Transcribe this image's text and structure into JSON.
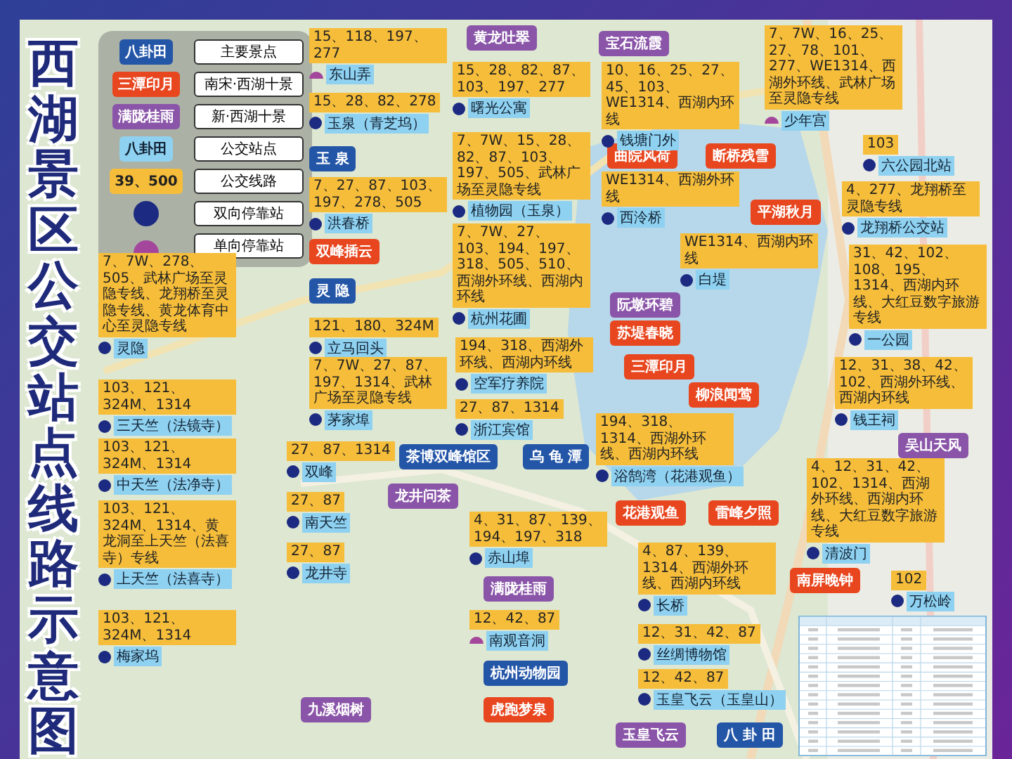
{
  "title": "西湖景区公交站点线路示意图",
  "legend": [
    {
      "kind": "main",
      "sample": "八卦田",
      "meaning": "主要景点"
    },
    {
      "kind": "old",
      "sample": "三潭印月",
      "meaning": "南宋·西湖十景"
    },
    {
      "kind": "new",
      "sample": "满陇桂雨",
      "meaning": "新·西湖十景"
    },
    {
      "kind": "stop",
      "sample": "八卦田",
      "meaning": "公交站点"
    },
    {
      "kind": "routes",
      "sample": "39、500",
      "meaning": "公交线路"
    },
    {
      "kind": "double",
      "meaning": "双向停靠站"
    },
    {
      "kind": "single",
      "meaning": "单向停靠站"
    }
  ],
  "scenic_spots": [
    {
      "name": "黄龙吐翠",
      "kind": "new"
    },
    {
      "name": "宝石流霞",
      "kind": "new"
    },
    {
      "name": "玉 泉",
      "kind": "main"
    },
    {
      "name": "曲院风荷",
      "kind": "old"
    },
    {
      "name": "断桥残雪",
      "kind": "old"
    },
    {
      "name": "平湖秋月",
      "kind": "old"
    },
    {
      "name": "双峰插云",
      "kind": "old"
    },
    {
      "name": "灵 隐",
      "kind": "main"
    },
    {
      "name": "阮墩环碧",
      "kind": "new"
    },
    {
      "name": "苏堤春晓",
      "kind": "old"
    },
    {
      "name": "三潭印月",
      "kind": "old"
    },
    {
      "name": "柳浪闻莺",
      "kind": "old"
    },
    {
      "name": "吴山天风",
      "kind": "new"
    },
    {
      "name": "茶博双峰馆区",
      "kind": "main"
    },
    {
      "name": "乌 龟 潭",
      "kind": "main"
    },
    {
      "name": "雷峰夕照",
      "kind": "old"
    },
    {
      "name": "花港观鱼",
      "kind": "old"
    },
    {
      "name": "南屏晚钟",
      "kind": "old"
    },
    {
      "name": "龙井问茶",
      "kind": "new"
    },
    {
      "name": "满陇桂雨",
      "kind": "new"
    },
    {
      "name": "杭州动物园",
      "kind": "main"
    },
    {
      "name": "虎跑梦泉",
      "kind": "old"
    },
    {
      "name": "玉皇飞云",
      "kind": "new"
    },
    {
      "name": "八 卦 田",
      "kind": "main"
    },
    {
      "name": "九溪烟树",
      "kind": "new"
    }
  ],
  "stops": [
    {
      "name": "东山弄",
      "kind": "single",
      "routes": "15、118、197、277"
    },
    {
      "name": "曙光公寓",
      "kind": "double",
      "routes": "15、28、82、87、103、197、277"
    },
    {
      "name": "钱塘门外",
      "kind": "double",
      "routes": "10、16、25、27、45、103、WE1314、西湖内环线"
    },
    {
      "name": "少年宫",
      "kind": "single",
      "routes": "7、7W、16、25、27、78、101、277、WE1314、西湖外环线、武林广场至灵隐专线"
    },
    {
      "name": "六公园北站",
      "kind": "double",
      "routes": "103"
    },
    {
      "name": "龙翔桥公交站",
      "kind": "double",
      "routes": "4、277、龙翔桥至灵隐专线"
    },
    {
      "name": "玉泉（青芝坞）",
      "kind": "double",
      "routes": "15、28、82、278"
    },
    {
      "name": "植物园（玉泉）",
      "kind": "double",
      "routes": "7、7W、15、28、82、87、103、197、505、武林广场至灵隐专线"
    },
    {
      "name": "西泠桥",
      "kind": "double",
      "routes": "WE1314、西湖外环线"
    },
    {
      "name": "白堤",
      "kind": "double",
      "routes": "WE1314、西湖内环线"
    },
    {
      "name": "一公园",
      "kind": "double",
      "routes": "31、42、102、108、195、1314、西湖内环线、大红豆数字旅游专线"
    },
    {
      "name": "洪春桥",
      "kind": "double",
      "routes": "7、27、87、103、197、278、505"
    },
    {
      "name": "杭州花圃",
      "kind": "double",
      "routes": "7、7W、27、103、194、197、318、505、510、西湖外环线、西湖内环线"
    },
    {
      "name": "灵隐",
      "kind": "double",
      "routes": "7、7W、278、505、武林广场至灵隐专线、龙翔桥至灵隐专线、黄龙体育中心至灵隐专线"
    },
    {
      "name": "立马回头",
      "kind": "double",
      "routes": "121、180、324M"
    },
    {
      "name": "三天竺（法镜寺）",
      "kind": "double",
      "routes": "103、121、324M、1314"
    },
    {
      "name": "中天竺（法净寺）",
      "kind": "double",
      "routes": "103、121、324M、1314"
    },
    {
      "name": "上天竺（法喜寺）",
      "kind": "double",
      "routes": "103、121、324M、1314、黄龙洞至上天竺（法喜寺）专线"
    },
    {
      "name": "茅家埠",
      "kind": "double",
      "routes": "7、7W、27、87、197、1314、武林广场至灵隐专线"
    },
    {
      "name": "空军疗养院",
      "kind": "double",
      "routes": "194、318、西湖外环线、西湖内环线"
    },
    {
      "name": "浙江宾馆",
      "kind": "double",
      "routes": "27、87、1314"
    },
    {
      "name": "钱王祠",
      "kind": "double",
      "routes": "12、31、38、42、102、西湖外环线、西湖内环线"
    },
    {
      "name": "双峰",
      "kind": "double",
      "routes": "27、87、1314"
    },
    {
      "name": "浴鹄湾（花港观鱼）",
      "kind": "double",
      "routes": "194、318、1314、西湖外环线、西湖内环线"
    },
    {
      "name": "清波门",
      "kind": "double",
      "routes": "4、12、31、42、102、1314、西湖外环线、西湖内环线、大红豆数字旅游专线"
    },
    {
      "name": "长桥",
      "kind": "double",
      "routes": "4、87、139、1314、西湖外环线、西湖内环线"
    },
    {
      "name": "南天竺",
      "kind": "double",
      "routes": "27、87"
    },
    {
      "name": "龙井寺",
      "kind": "double",
      "routes": "27、87"
    },
    {
      "name": "赤山埠",
      "kind": "double",
      "routes": "4、31、87、139、194、197、318"
    },
    {
      "name": "丝绸博物馆",
      "kind": "double",
      "routes": "12、31、42、87"
    },
    {
      "name": "玉皇飞云（玉皇山）",
      "kind": "double",
      "routes": "12、42、87"
    },
    {
      "name": "万松岭",
      "kind": "double",
      "routes": "102"
    },
    {
      "name": "梅家坞",
      "kind": "double",
      "routes": "103、121、324M、1314"
    },
    {
      "name": "南观音洞",
      "kind": "single",
      "routes": "12、42、87"
    }
  ]
}
